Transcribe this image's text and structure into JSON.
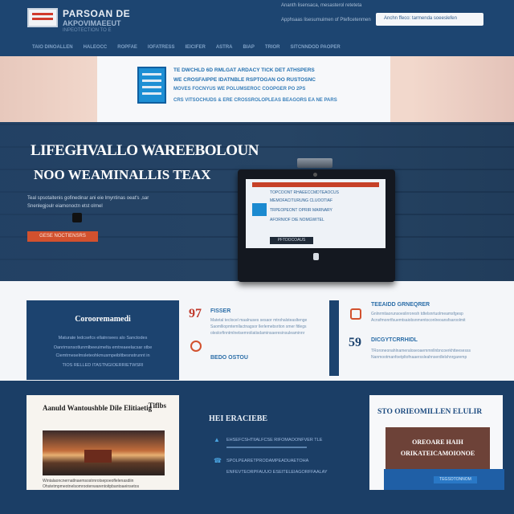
{
  "header": {
    "brand": "PARSOAN DE",
    "brand_sub": "AKPOVIMAEEUT",
    "tagline": "INPEOTECTION TO E",
    "line1": "Ananth lisensaca, mesasterol reteteta",
    "line2": "Apphsaas lisesumuimen of Pteflcetenmen",
    "search_placeholder": "Anchn ffeco: tarmenda soeeslefen"
  },
  "nav": {
    "items": [
      "TAIO DINOALLEN",
      "HALEOCC",
      "ROPFAE",
      "IOFATRESS",
      "IEICIFER",
      "ASTRA",
      "BIAP",
      "TRIOR",
      "SITCNNDOD PAOPER"
    ]
  },
  "banner": {
    "line1": "TE DWCHLD 6D RMLGAT ARDACY TICK DET ATHSPERS",
    "line2": "WE CROSFAIPPE IDATNBLE RSPTOGAN OO RUSTOSNC",
    "line3": "MOVES FOCNYUS WE POLUMSEROC COOPGER PO 2PS",
    "line4": "CRS VITSOCHUDS & ERE CROSSROLOPLEAS BEAGORS EA NE PARS"
  },
  "hero": {
    "title1": "LIFEGHVALLO WAREEBOLOUN",
    "title2": "NOO WEAMINALLIS TEAX",
    "sub1": "Teal spsotaitenis gofinedinar ani eie lmyntinas oeat's ,sar",
    "sub2": "Snenlegjoulr eiamonoctn etst olrnel",
    "cta": "GESE NOCTIENSRS",
    "screen_line1": "TOPCOONT RHAEECCMDTEAOCUS",
    "screen_line2": "MEMOFACITURUNG CLUOOTIAF",
    "screen_line3": "TRPEOPEONT OPRIR MARNARY",
    "screen_line4": "AFORNIOF DIE NOMGWITEL",
    "screen_btn": "PFTDOCOAUS"
  },
  "features": {
    "card_title": "Corooremamedi",
    "card_lines": [
      "Maturate ledcsefcs ellatnrsees alo Sanctodes",
      "Oanrimsnsotlunmlbeeuimelta emtreaeelacsar stbe",
      "Ciemtrneselmsleteohkmusmpeibltbesnstrunnt in",
      "TIOS RELLED ITASTNGIOERRIETWSRI"
    ],
    "stat1_num": "97",
    "stat1_label": "FISSER",
    "stat1_lines": [
      "Matetal teclocel maalnuses sesaor mtrohalsteasltenge",
      "Saomlliopmtemllactnagsor llerlemebsriton smer fitlegs",
      "oleslorfinntmlnetsemroliatisdaminsaeresinsuleaminnr"
    ],
    "stat2_label": "BEDO OSTOU",
    "stat3_label": "TEEAIDD GRNEQRER",
    "stat3_lines": [
      "Gnlnrmtiaorunsoeslirroresh tdtelsnrtuolmeamsfgesp",
      "Acnsfmonrtfsuemtsaiobsnmentoconlreoansfsaroolmit"
    ],
    "stat4_num": "59",
    "stat4_label": "DICGYTCRRHIDL",
    "stat4_lines": [
      "TRoroneonahlnameraloseoaemmnllnbncoerkhtteesesss",
      "Nanmootmanfoetpltofnaaerssleahnserdlelshnrgaremp"
    ]
  },
  "bottom": {
    "news_title": "Aanuld Wantoushble Dile Elitiaetig",
    "news_badge": "Tiflbs",
    "news_lines": [
      "Wintalaoncnernatlnaemsostrnrotsepoeoflelenasdiin",
      "Ohstetmpmeotnelsomrootenwarentoitpbantoaeinsetos"
    ],
    "help_title": "HEI ERACIEBE",
    "help_items": [
      "EHSEFCSHTIIALFCSE RIFOMAOONFVER TLE",
      "SPOLPEARETPRODAMPEADUAETOHA",
      "ENFEVTEORPFAUUO ESEITELEIAGORFFAALAY"
    ],
    "promo_title": "STO ORIEOMILLEN ELULIR",
    "promo_line1": "OREOARE HAIH",
    "promo_line2": "ORIKATEICAMOIONOE",
    "promo_btn": "TEGSOTONNOM"
  }
}
